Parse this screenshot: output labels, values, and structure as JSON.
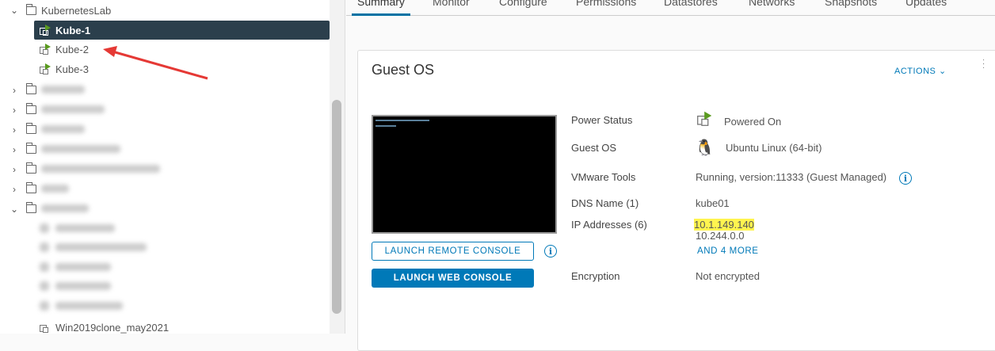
{
  "tree": {
    "folder": "KubernetesLab",
    "vms": [
      {
        "label": "Kube-1",
        "selected": true
      },
      {
        "label": "Kube-2"
      },
      {
        "label": "Kube-3"
      }
    ],
    "last_item": "Win2019clone_may2021"
  },
  "tabs": [
    "Summary",
    "Monitor",
    "Configure",
    "Permissions",
    "Datastores",
    "Networks",
    "Snapshots",
    "Updates"
  ],
  "card": {
    "title": "Guest OS",
    "actions": "ACTIONS",
    "launch_remote": "LAUNCH REMOTE CONSOLE",
    "launch_web": "LAUNCH WEB CONSOLE",
    "props": {
      "power_label": "Power Status",
      "power_value": "Powered On",
      "os_label": "Guest OS",
      "os_value": "Ubuntu Linux (64-bit)",
      "tools_label": "VMware Tools",
      "tools_value": "Running, version:11333 (Guest Managed)",
      "dns_label": "DNS Name (1)",
      "dns_value": "kube01",
      "ip_label": "IP Addresses (6)",
      "ip1": "10.1.149.140",
      "ip2": "10.244.0.0",
      "more": "AND 4 MORE",
      "enc_label": "Encryption",
      "enc_value": "Not encrypted"
    }
  },
  "colors": {
    "accent": "#0079b8",
    "selected": "#2b3f4c",
    "highlight": "#fff44f",
    "arrow": "#e53935"
  }
}
